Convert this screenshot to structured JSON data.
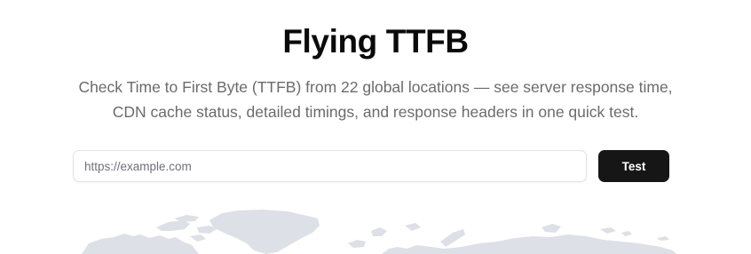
{
  "header": {
    "title": "Flying TTFB",
    "subtitle": "Check Time to First Byte (TTFB) from 22 global locations — see server response time, CDN cache status, detailed timings, and response headers in one quick test."
  },
  "form": {
    "url_placeholder": "https://example.com",
    "url_value": "",
    "submit_label": "Test"
  },
  "colors": {
    "map_land": "#dde0e6",
    "button_bg": "#161616"
  }
}
